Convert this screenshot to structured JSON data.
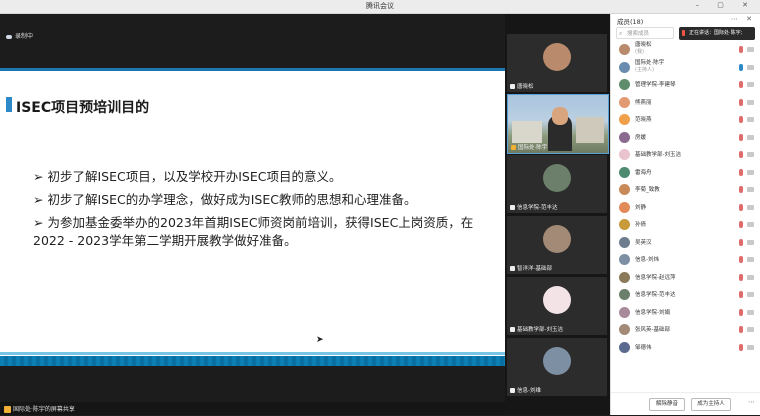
{
  "window": {
    "title": "腾讯会议",
    "controls": "– ▢ ✕"
  },
  "main": {
    "recording_label": "录制中",
    "slide": {
      "title": "ISEC项目预培训目的",
      "bullets": [
        "初步了解ISEC项目，以及学校开办ISEC项目的意义。",
        "初步了解ISEC的办学理念，做好成为ISEC教师的思想和心理准备。",
        "为参加基金委举办的2023年首期ISEC师资岗前培训，获得ISEC上岗资质，在2022 - 2023学年第二学期开展教学做好准备。"
      ]
    },
    "share_label": "国际处·陈宇的屏幕共享"
  },
  "filmstrip": {
    "tiles": [
      {
        "label": "唐晓松",
        "avatar_color": "#b98a6b"
      },
      {
        "label": "国际处·陈宇",
        "avatar_color": "video"
      },
      {
        "label": "信息学院-范丰达",
        "avatar_color": "#6b7f6a"
      },
      {
        "label": "智洋洋-基础部",
        "avatar_color": "#a38a76"
      },
      {
        "label": "基础教学部-刘玉洁",
        "avatar_color": "#e9c3cd"
      },
      {
        "label": "信息-刘维",
        "avatar_color": "#7d8fa3"
      }
    ]
  },
  "sidebar": {
    "header": "成员(18)",
    "header_icons": "⋯ ✕",
    "search_placeholder": "搜索成员",
    "speaking_text": "正在讲话：国际处·陈宇;",
    "participants": [
      {
        "name": "唐晓松",
        "sub": "(我)",
        "av": "#b98a6b"
      },
      {
        "name": "国际处·陈宇",
        "sub": "(主持人)",
        "av": "#6a8cae"
      },
      {
        "name": "管理学院-李建琴",
        "sub": "",
        "av": "#5f8d6b"
      },
      {
        "name": "熊燕丽",
        "sub": "",
        "av": "#e29a72"
      },
      {
        "name": "范晓燕",
        "sub": "",
        "av": "#f0a04b"
      },
      {
        "name": "房媛",
        "sub": "",
        "av": "#8a6a8e"
      },
      {
        "name": "基础教学部-刘玉洁",
        "sub": "",
        "av": "#e9c3cd"
      },
      {
        "name": "雷海舟",
        "sub": "",
        "av": "#4d8a6f"
      },
      {
        "name": "李菊_致教",
        "sub": "",
        "av": "#c98a5a"
      },
      {
        "name": "刘静",
        "sub": "",
        "av": "#e28a5a"
      },
      {
        "name": "孙倩",
        "sub": "",
        "av": "#c89a3a"
      },
      {
        "name": "吴英汉",
        "sub": "",
        "av": "#6d7d8e"
      },
      {
        "name": "信息-刘炜",
        "sub": "",
        "av": "#7d8fa3"
      },
      {
        "name": "信息学院-赵远萍",
        "sub": "",
        "av": "#8a7a5a"
      },
      {
        "name": "信息学院-范丰达",
        "sub": "",
        "av": "#6b7f6a"
      },
      {
        "name": "信息学院-刘娟",
        "sub": "",
        "av": "#a88a9a"
      },
      {
        "name": "张风英-基础部",
        "sub": "",
        "av": "#a38a76"
      },
      {
        "name": "邹德伟",
        "sub": "",
        "av": "#5a6a8e"
      }
    ],
    "footer": {
      "mute_all": "解除静音",
      "host": "成为主持人",
      "more": "⋯"
    }
  }
}
